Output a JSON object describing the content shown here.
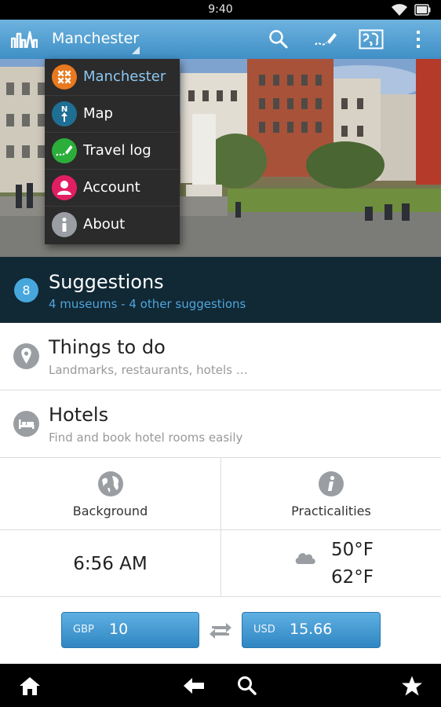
{
  "status_bar": {
    "time": "9:40",
    "icons": [
      "wifi-icon",
      "battery-icon"
    ]
  },
  "action_bar": {
    "selected_city": "Manchester",
    "actions": [
      "search-icon",
      "travel-log-icon",
      "map-icon",
      "overflow-menu-icon"
    ]
  },
  "dropdown": {
    "items": [
      {
        "label": "Manchester",
        "icon": "city-icon",
        "color": "#e8791e",
        "selected": true
      },
      {
        "label": "Map",
        "icon": "compass-icon",
        "color": "#1f6f95"
      },
      {
        "label": "Travel log",
        "icon": "travel-log-icon",
        "color": "#2cae3a"
      },
      {
        "label": "Account",
        "icon": "account-icon",
        "color": "#e21e63"
      },
      {
        "label": "About",
        "icon": "info-icon",
        "color": "#9a9ea2"
      }
    ]
  },
  "suggestions": {
    "count": "8",
    "title": "Suggestions",
    "subtitle": "4 museums - 4 other suggestions"
  },
  "rows": [
    {
      "title": "Things to do",
      "subtitle": "Landmarks, restaurants, hotels …",
      "icon": "location-pin-icon"
    },
    {
      "title": "Hotels",
      "subtitle": "Find and book hotel rooms easily",
      "icon": "bed-icon"
    }
  ],
  "grid": {
    "background_label": "Background",
    "practicalities_label": "Practicalities",
    "local_time": "6:56 AM",
    "temp_high": "50°F",
    "temp_low": "62°F",
    "weather_icon": "cloud-icon"
  },
  "currency": {
    "from_code": "GBP",
    "from_amount": "10",
    "to_code": "USD",
    "to_amount": "15.66"
  },
  "nav_bar": {
    "items": [
      "home-icon",
      "back-icon",
      "search-icon",
      "star-icon"
    ]
  },
  "colors": {
    "accent": "#47a6dc",
    "action_bar": "#4f9fd2",
    "suggest_bg": "#112835"
  }
}
